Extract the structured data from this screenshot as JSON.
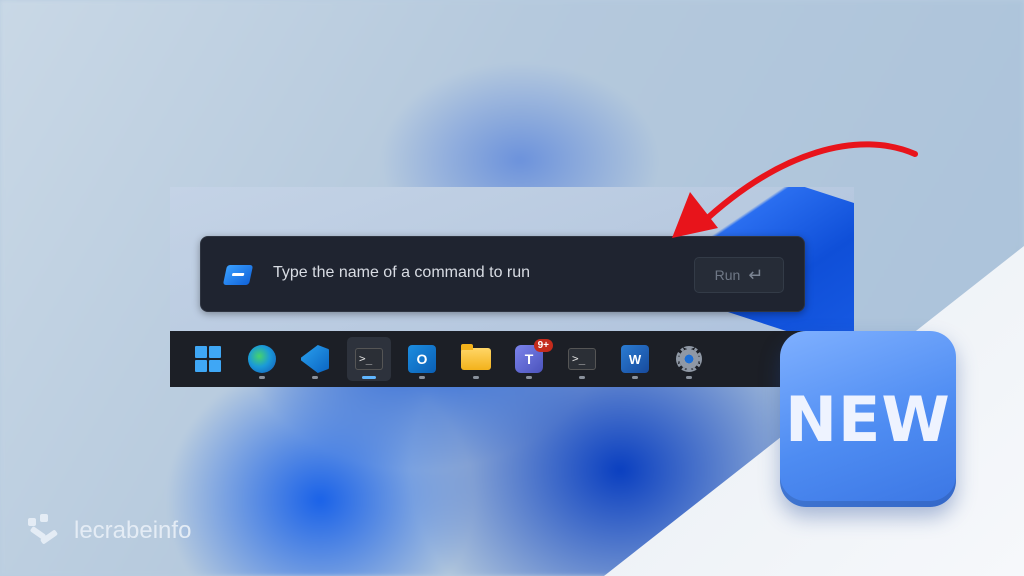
{
  "run_dialog": {
    "placeholder": "Type the name of a command to run",
    "run_label": "Run",
    "return_glyph": "↵"
  },
  "taskbar": {
    "items": [
      {
        "name": "start",
        "icon": "windows-logo-icon"
      },
      {
        "name": "edge",
        "icon": "edge-icon"
      },
      {
        "name": "vscode",
        "icon": "vscode-icon"
      },
      {
        "name": "terminal-active",
        "icon": "terminal-icon",
        "glyph": ">_"
      },
      {
        "name": "outlook",
        "icon": "outlook-icon",
        "glyph": "O"
      },
      {
        "name": "file-explorer",
        "icon": "folder-icon"
      },
      {
        "name": "teams",
        "icon": "teams-icon",
        "glyph": "T",
        "badge": "9+"
      },
      {
        "name": "terminal",
        "icon": "terminal-icon",
        "glyph": ">_"
      },
      {
        "name": "word",
        "icon": "word-icon",
        "glyph": "W"
      },
      {
        "name": "settings",
        "icon": "gear-icon"
      }
    ]
  },
  "badge_text": "NEW",
  "brand": "lecrabeinfo",
  "colors": {
    "accent": "#3b76e4",
    "arrow": "#e8141b",
    "dark": "#1f2430"
  }
}
